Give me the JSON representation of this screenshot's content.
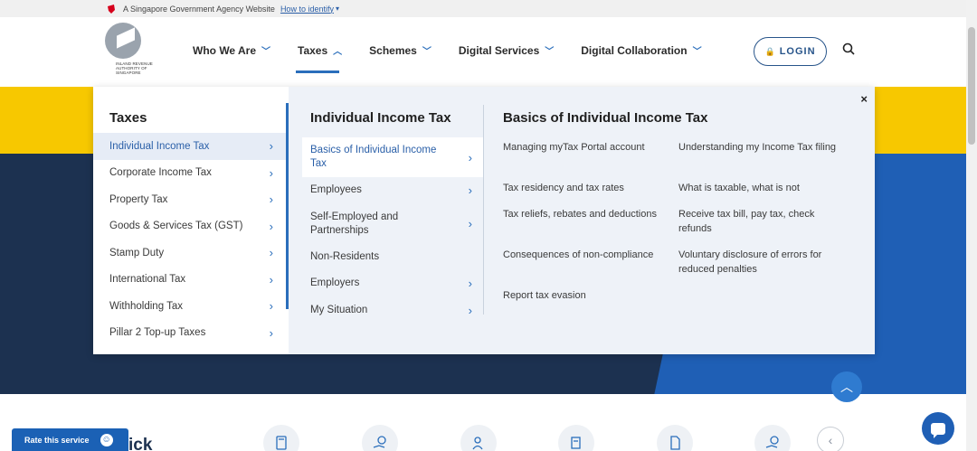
{
  "gov_bar": {
    "text": "A Singapore Government Agency Website",
    "link": "How to identify",
    "chevron": "▾"
  },
  "logo": {
    "text": "INLAND REVENUE AUTHORITY OF SINGAPORE"
  },
  "nav": {
    "items": [
      {
        "label": "Who We Are",
        "chevron": "﹀"
      },
      {
        "label": "Taxes",
        "chevron": "︿"
      },
      {
        "label": "Schemes",
        "chevron": "﹀"
      },
      {
        "label": "Digital Services",
        "chevron": "﹀"
      },
      {
        "label": "Digital Collaboration",
        "chevron": "﹀"
      }
    ],
    "login": "LOGIN",
    "login_icon": "🔒"
  },
  "mega_menu": {
    "close": "×",
    "chevron": "›",
    "taxes": {
      "heading": "Taxes",
      "items": [
        "Individual Income Tax",
        "Corporate Income Tax",
        "Property Tax",
        "Goods & Services Tax (GST)",
        "Stamp Duty",
        "International Tax",
        "Withholding Tax",
        "Pillar 2 Top-up Taxes"
      ]
    },
    "individual": {
      "heading": "Individual Income Tax",
      "items": [
        "Basics of Individual Income Tax",
        "Employees",
        "Self-Employed and Partnerships",
        "Non-Residents",
        "Employers",
        "My Situation"
      ]
    },
    "basics": {
      "heading": "Basics of Individual Income Tax",
      "links": [
        "Managing myTax Portal account",
        "Understanding my Income Tax filing",
        "Tax residency and tax rates",
        "What is taxable, what is not",
        "Tax reliefs, rebates and deductions",
        "Receive tax bill, pay tax, check refunds",
        "Consequences of non-compliance",
        "Voluntary disclosure of errors for reduced penalties",
        "Report tax evasion"
      ]
    }
  },
  "quick": {
    "title_partial": "ick",
    "prev": "‹"
  },
  "rate": {
    "label": "Rate this service",
    "smile": "☺"
  },
  "scroll_top": "︿",
  "colors": {
    "brand_blue": "#2a6ebb",
    "navy": "#1c3150",
    "yellow": "#f7c800"
  }
}
